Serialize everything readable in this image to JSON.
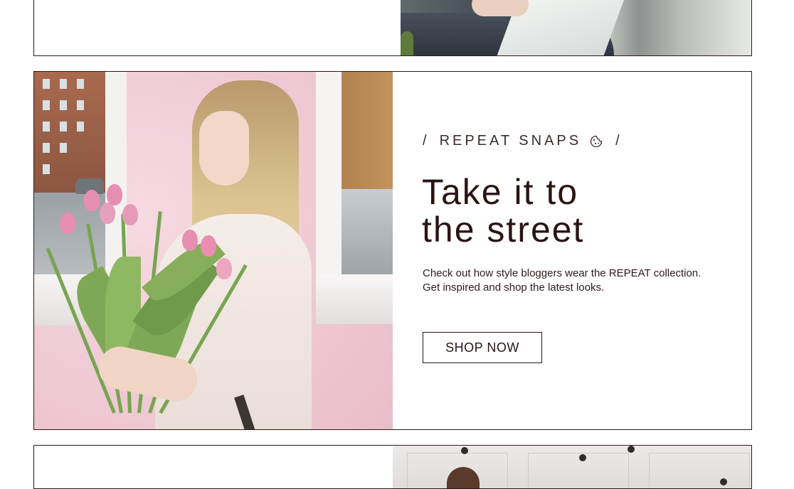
{
  "promo": {
    "tagline": {
      "prefix": "/",
      "text": "REPEAT SNAPS",
      "icon": "cookie-icon",
      "suffix": "/"
    },
    "headline": [
      "Take it to",
      "the street"
    ],
    "description": [
      "Check out how style bloggers wear the REPEAT collection.",
      "Get inspired and shop the latest looks."
    ],
    "cta_label": "SHOP NOW"
  },
  "colors": {
    "text": "#2b1414",
    "border": "#2b1a1a",
    "background": "#ffffff",
    "photo_wall": "#f0cfd8"
  }
}
